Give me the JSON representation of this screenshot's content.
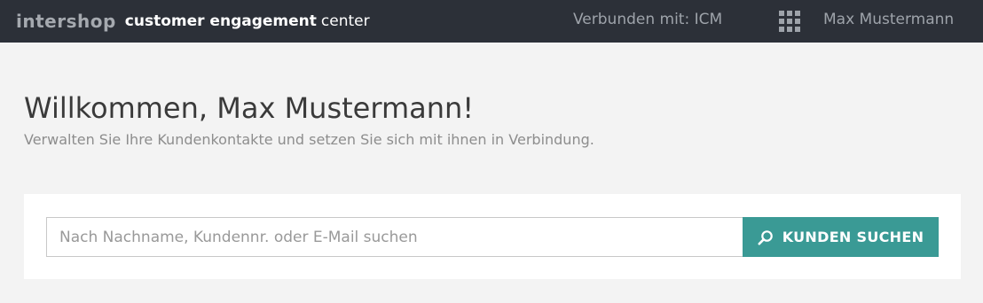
{
  "header": {
    "logo_text": "intershop",
    "app_name_bold": "customer engagement",
    "app_name_light": "center",
    "connection_status": "Verbunden mit: ICM",
    "apps_icon": "grid-icon",
    "user_name": "Max Mustermann"
  },
  "main": {
    "welcome_title": "Willkommen, Max Mustermann!",
    "welcome_subtitle": "Verwalten Sie Ihre Kundenkontakte und setzen Sie sich mit ihnen in Verbindung."
  },
  "search": {
    "placeholder": "Nach Nachname, Kundennr. oder E-Mail suchen",
    "value": "",
    "button_label": "KUNDEN SUCHEN",
    "button_icon": "search-icon"
  },
  "colors": {
    "header_bg": "#2c3038",
    "page_bg": "#f3f3f3",
    "accent": "#3a9a95"
  }
}
